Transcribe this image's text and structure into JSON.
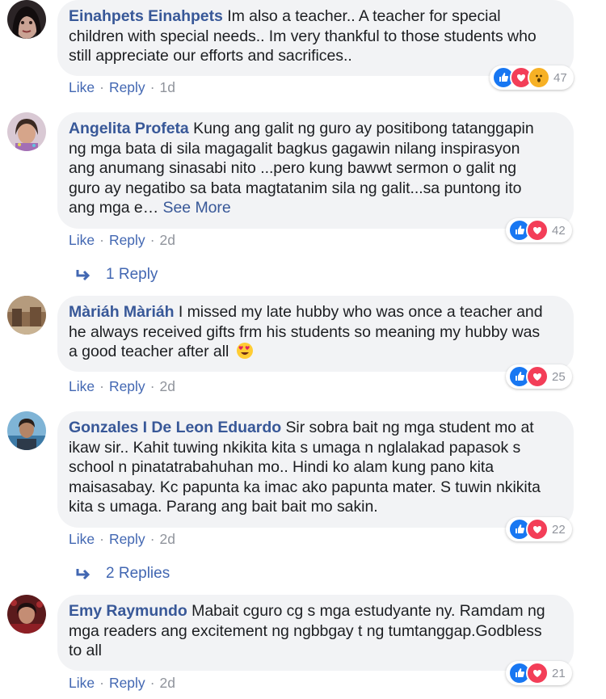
{
  "actions": {
    "like": "Like",
    "reply": "Reply",
    "dot": "·"
  },
  "comments": [
    {
      "author": "Einahpets Einahpets",
      "lines": [
        "Im also a teacher.. A teacher for special",
        "children with special needs.. Im very thankful to those students who",
        "still appreciate our efforts and sacrifices.."
      ],
      "time": "1d",
      "reactions": [
        "like-icon",
        "love-icon",
        "wow-icon"
      ],
      "reaction_count": "47"
    },
    {
      "author": "Angelita Profeta",
      "lines": [
        "Kung ang galit ng guro ay positibong tatanggapin",
        "ng mga bata di sila magagalit bagkus gagawin nilang inspirasyon",
        "ang anumang sinasabi nito ...pero kung bawwt sermon o galit ng",
        "guro ay negatibo sa bata magtatanim sila ng galit...sa puntong ito",
        "ang mga e…"
      ],
      "see_more": "See More",
      "time": "2d",
      "reactions": [
        "like-icon",
        "love-icon"
      ],
      "reaction_count": "42",
      "replies_label": "1 Reply"
    },
    {
      "author": "Màriáh Màriáh",
      "lines": [
        "I missed my late hubby who was once a teacher and",
        "he always received gifts frm his students so meaning my hubby was",
        "a good teacher after all"
      ],
      "emoji": "heart-eyes-emoji",
      "time": "2d",
      "reactions": [
        "like-icon",
        "love-icon"
      ],
      "reaction_count": "25"
    },
    {
      "author": "Gonzales I De Leon Eduardo",
      "lines": [
        "Sir sobra bait ng mga student mo at",
        "ikaw sir.. Kahit tuwing nkikita kita s umaga n nglalakad papasok s",
        "school n pinatatrabahuhan mo.. Hindi ko alam kung pano kita",
        "maisasabay. Kc papunta ka imac ako papunta mater. S tuwin nkikita",
        "kita s umaga. Parang ang bait bait mo sakin."
      ],
      "time": "2d",
      "reactions": [
        "like-icon",
        "love-icon"
      ],
      "reaction_count": "22",
      "replies_label": "2 Replies"
    },
    {
      "author": "Emy Raymundo",
      "lines": [
        "Mabait cguro cg s mga estudyante ny. Ramdam ng",
        "mga readers ang excitement ng ngbbgay t ng tumtanggap.Godbless",
        "to all"
      ],
      "time": "2d",
      "reactions": [
        "like-icon",
        "love-icon"
      ],
      "reaction_count": "21"
    }
  ]
}
